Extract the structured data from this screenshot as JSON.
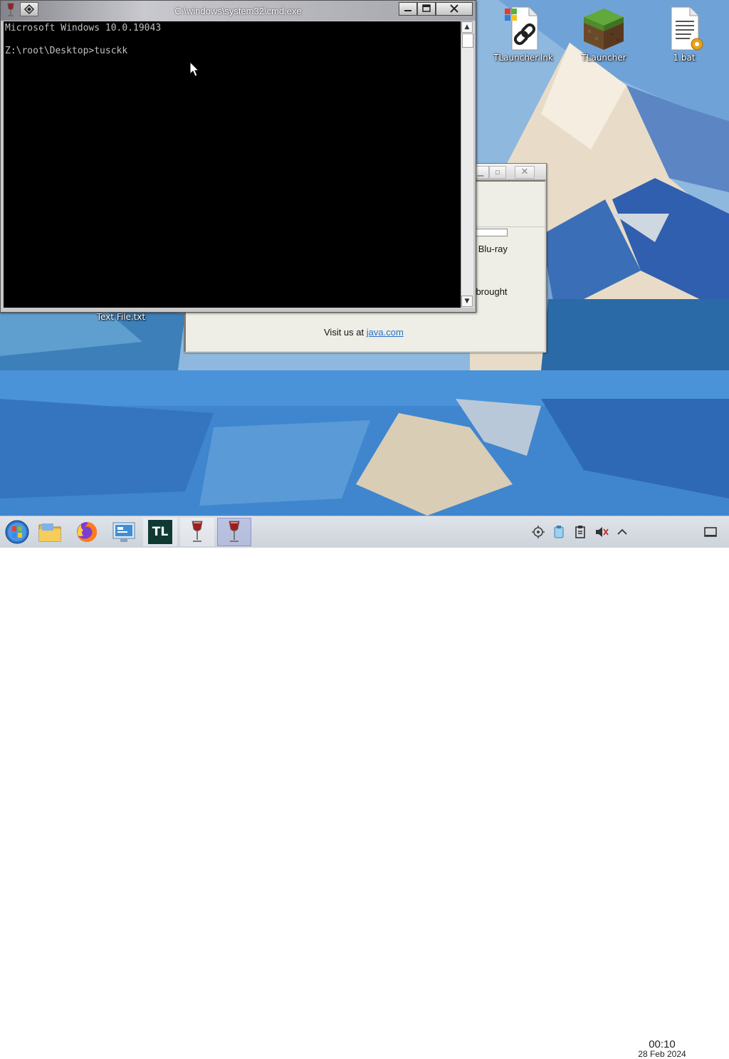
{
  "cmd": {
    "title": "C:\\windows\\system32\\cmd.exe",
    "lines": [
      "Microsoft Windows 10.0.19043",
      "",
      "Z:\\root\\Desktop>tusckk"
    ]
  },
  "java_dialog": {
    "line1": "s, Blu-ray",
    "line2": "a, brought",
    "visit_prefix": "Visit us at",
    "visit_link": "java.com"
  },
  "desktop_icons": [
    {
      "label": "TLauncher.lnk",
      "icon": "shortcut-icon"
    },
    {
      "label": "TLauncher",
      "icon": "grass-block-icon"
    },
    {
      "label": "1.bat",
      "icon": "batch-file-icon"
    },
    {
      "label": "Text File.txt",
      "icon": "text-file-icon"
    }
  ],
  "taskbar": {
    "items": [
      "start-menu",
      "file-manager",
      "firefox",
      "control-panel",
      "tlauncher",
      "wine-app",
      "wine-app-active"
    ],
    "tlauncher_text": "TL"
  },
  "tray": {
    "time": "00:10",
    "date": "28 Feb 2024"
  },
  "colors": {
    "console_bg": "#000000",
    "console_fg": "#c0c0c0",
    "link": "#2a6fc9"
  }
}
